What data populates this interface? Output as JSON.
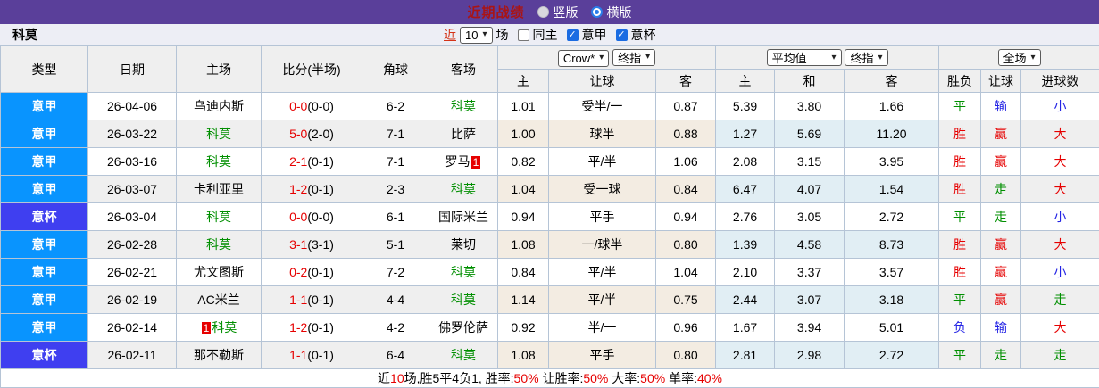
{
  "topbar": {
    "title": "近期战绩",
    "radio_vertical": "竖版",
    "radio_horizontal": "横版",
    "radio_selected": "横版"
  },
  "controls": {
    "team": "科莫",
    "recent_label": "近",
    "recent_value": "10",
    "matches_label": "场",
    "checkbox_same_home": "同主",
    "checkbox_serie_a": "意甲",
    "checkbox_coppa": "意杯",
    "same_home_checked": false,
    "serie_a_checked": true,
    "coppa_checked": true
  },
  "table": {
    "selects": {
      "bookmaker": "Crow*",
      "stage_handicap": "终指",
      "average": "平均值",
      "stage_europe": "终指",
      "full_match": "全场"
    },
    "columns": [
      "类型",
      "日期",
      "主场",
      "比分(半场)",
      "角球",
      "客场",
      "主",
      "让球",
      "客",
      "主",
      "和",
      "客",
      "胜负",
      "让球",
      "进球数"
    ],
    "rows": [
      {
        "league": "意甲",
        "date": "26-04-06",
        "home": {
          "name": "乌迪内斯",
          "color": "black"
        },
        "score_ft": "0-0",
        "score_ht": "(0-0)",
        "corner": "6-2",
        "away": {
          "name": "科莫",
          "color": "green"
        },
        "ah": [
          "1.01",
          "受半/一",
          "0.87"
        ],
        "eu": [
          "5.39",
          "3.80",
          "1.66"
        ],
        "results": [
          {
            "t": "平",
            "c": "green"
          },
          {
            "t": "输",
            "c": "blue"
          },
          {
            "t": "小",
            "c": "blue"
          }
        ]
      },
      {
        "league": "意甲",
        "date": "26-03-22",
        "home": {
          "name": "科莫",
          "color": "green"
        },
        "score_ft": "5-0",
        "score_ht": "(2-0)",
        "corner": "7-1",
        "away": {
          "name": "比萨",
          "color": "black"
        },
        "ah": [
          "1.00",
          "球半",
          "0.88"
        ],
        "eu": [
          "1.27",
          "5.69",
          "11.20"
        ],
        "results": [
          {
            "t": "胜",
            "c": "red"
          },
          {
            "t": "赢",
            "c": "red"
          },
          {
            "t": "大",
            "c": "red"
          }
        ]
      },
      {
        "league": "意甲",
        "date": "26-03-16",
        "home": {
          "name": "科莫",
          "color": "green"
        },
        "score_ft": "2-1",
        "score_ht": "(0-1)",
        "corner": "7-1",
        "away": {
          "name": "罗马",
          "color": "black",
          "badge": "1",
          "badge_pos": "after"
        },
        "ah": [
          "0.82",
          "平/半",
          "1.06"
        ],
        "eu": [
          "2.08",
          "3.15",
          "3.95"
        ],
        "results": [
          {
            "t": "胜",
            "c": "red"
          },
          {
            "t": "赢",
            "c": "red"
          },
          {
            "t": "大",
            "c": "red"
          }
        ]
      },
      {
        "league": "意甲",
        "date": "26-03-07",
        "home": {
          "name": "卡利亚里",
          "color": "black"
        },
        "score_ft": "1-2",
        "score_ht": "(0-1)",
        "corner": "2-3",
        "away": {
          "name": "科莫",
          "color": "green"
        },
        "ah": [
          "1.04",
          "受一球",
          "0.84"
        ],
        "eu": [
          "6.47",
          "4.07",
          "1.54"
        ],
        "results": [
          {
            "t": "胜",
            "c": "red"
          },
          {
            "t": "走",
            "c": "green"
          },
          {
            "t": "大",
            "c": "red"
          }
        ]
      },
      {
        "league": "意杯",
        "date": "26-03-04",
        "home": {
          "name": "科莫",
          "color": "green"
        },
        "score_ft": "0-0",
        "score_ht": "(0-0)",
        "corner": "6-1",
        "away": {
          "name": "国际米兰",
          "color": "black"
        },
        "ah": [
          "0.94",
          "平手",
          "0.94"
        ],
        "eu": [
          "2.76",
          "3.05",
          "2.72"
        ],
        "results": [
          {
            "t": "平",
            "c": "green"
          },
          {
            "t": "走",
            "c": "green"
          },
          {
            "t": "小",
            "c": "blue"
          }
        ]
      },
      {
        "league": "意甲",
        "date": "26-02-28",
        "home": {
          "name": "科莫",
          "color": "green"
        },
        "score_ft": "3-1",
        "score_ht": "(3-1)",
        "corner": "5-1",
        "away": {
          "name": "莱切",
          "color": "black"
        },
        "ah": [
          "1.08",
          "一/球半",
          "0.80"
        ],
        "eu": [
          "1.39",
          "4.58",
          "8.73"
        ],
        "results": [
          {
            "t": "胜",
            "c": "red"
          },
          {
            "t": "赢",
            "c": "red"
          },
          {
            "t": "大",
            "c": "red"
          }
        ]
      },
      {
        "league": "意甲",
        "date": "26-02-21",
        "home": {
          "name": "尤文图斯",
          "color": "black"
        },
        "score_ft": "0-2",
        "score_ht": "(0-1)",
        "corner": "7-2",
        "away": {
          "name": "科莫",
          "color": "green"
        },
        "ah": [
          "0.84",
          "平/半",
          "1.04"
        ],
        "eu": [
          "2.10",
          "3.37",
          "3.57"
        ],
        "results": [
          {
            "t": "胜",
            "c": "red"
          },
          {
            "t": "赢",
            "c": "red"
          },
          {
            "t": "小",
            "c": "blue"
          }
        ]
      },
      {
        "league": "意甲",
        "date": "26-02-19",
        "home": {
          "name": "AC米兰",
          "color": "black"
        },
        "score_ft": "1-1",
        "score_ht": "(0-1)",
        "corner": "4-4",
        "away": {
          "name": "科莫",
          "color": "green"
        },
        "ah": [
          "1.14",
          "平/半",
          "0.75"
        ],
        "eu": [
          "2.44",
          "3.07",
          "3.18"
        ],
        "results": [
          {
            "t": "平",
            "c": "green"
          },
          {
            "t": "赢",
            "c": "red"
          },
          {
            "t": "走",
            "c": "green"
          }
        ]
      },
      {
        "league": "意甲",
        "date": "26-02-14",
        "home": {
          "name": "科莫",
          "color": "green",
          "badge": "1",
          "badge_pos": "before"
        },
        "score_ft": "1-2",
        "score_ht": "(0-1)",
        "corner": "4-2",
        "away": {
          "name": "佛罗伦萨",
          "color": "black"
        },
        "ah": [
          "0.92",
          "半/一",
          "0.96"
        ],
        "eu": [
          "1.67",
          "3.94",
          "5.01"
        ],
        "results": [
          {
            "t": "负",
            "c": "blue"
          },
          {
            "t": "输",
            "c": "blue"
          },
          {
            "t": "大",
            "c": "red"
          }
        ]
      },
      {
        "league": "意杯",
        "date": "26-02-11",
        "home": {
          "name": "那不勒斯",
          "color": "black"
        },
        "score_ft": "1-1",
        "score_ht": "(0-1)",
        "corner": "6-4",
        "away": {
          "name": "科莫",
          "color": "green"
        },
        "ah": [
          "1.08",
          "平手",
          "0.80"
        ],
        "eu": [
          "2.81",
          "2.98",
          "2.72"
        ],
        "results": [
          {
            "t": "平",
            "c": "green"
          },
          {
            "t": "走",
            "c": "green"
          },
          {
            "t": "走",
            "c": "green"
          }
        ]
      }
    ]
  },
  "summary": {
    "segments": [
      {
        "text": "近",
        "color": "black"
      },
      {
        "text": "10",
        "color": "red"
      },
      {
        "text": "场,胜5平4负1, 胜率:",
        "color": "black"
      },
      {
        "text": "50%",
        "color": "red"
      },
      {
        "text": " 让胜率:",
        "color": "black"
      },
      {
        "text": "50%",
        "color": "red"
      },
      {
        "text": " 大率:",
        "color": "black"
      },
      {
        "text": "50%",
        "color": "red"
      },
      {
        "text": " 单率:",
        "color": "black"
      },
      {
        "text": "40%",
        "color": "red"
      }
    ]
  },
  "colors": {
    "league": {
      "意甲": "#0994fe",
      "意杯": "#3f3ff0"
    },
    "topbar": "#5a3f9a",
    "title_red": "#aa1414",
    "score_red": "#e60000",
    "team_green": "#008f00",
    "result_blue": "#2323e5"
  }
}
